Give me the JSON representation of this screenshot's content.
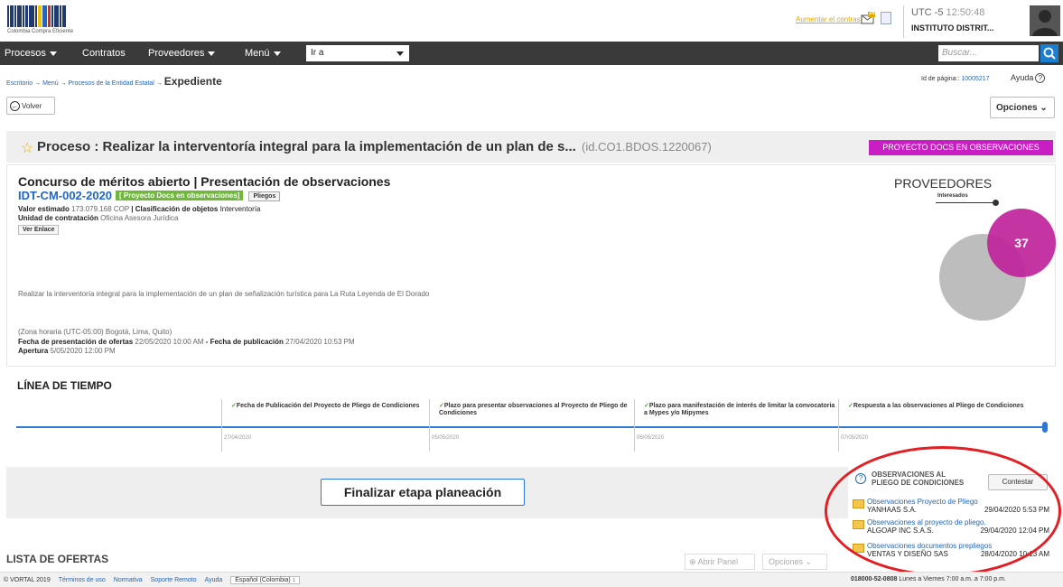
{
  "header": {
    "logo_text": "Colombia Compra Eficiente",
    "contrast_link": "Aumentar el contraste",
    "notification_count": "24",
    "utc_label": "UTC -5",
    "time": "12:50:48",
    "organization": "INSTITUTO DISTRIT..."
  },
  "nav": {
    "items": [
      "Procesos",
      "Contratos",
      "Proveedores",
      "Menú"
    ],
    "goto_value": "Ir a",
    "search_placeholder": "Buscar..."
  },
  "breadcrumb": {
    "items": [
      "Escritorio",
      "Menú",
      "Procesos de la Entidad Estatal"
    ],
    "current": "Expediente",
    "page_id_label": "Id de página::",
    "page_id": "10005217",
    "help_label": "Ayuda"
  },
  "buttons": {
    "back": "Volver",
    "options": "Opciones"
  },
  "process": {
    "title": "Proceso : Realizar la interventoría integral para la implementación de un plan de s...",
    "id": "(id.CO1.BDOS.1220067)",
    "status": "PROYECTO DOCS EN OBSERVACIONES",
    "modality": "Concurso de méritos abierto | Presentación de observaciones",
    "reference": "IDT-CM-002-2020",
    "phase_badge": "[ Proyecto Docs en observaciones]",
    "pliegos_tag": "Pliegos",
    "valor_label": "Valor estimado",
    "valor": "173.079.168 COP",
    "clasif_label": "| Clasificación de objetos",
    "clasif": "Interventoría",
    "unidad_label": "Unidad de contratación",
    "unidad": "Oficina Asesora Jurídica",
    "ver_enlace": "Ver Enlace",
    "description": "Realizar la interventoría integral para la implementación de un plan de señalización turística para La Ruta Leyenda de El Dorado",
    "timezone": "(Zona horaria (UTC-05:00) Bogotá, Lima, Quito)",
    "fecha_ofertas_label": "Fecha de presentación de ofertas",
    "fecha_ofertas": "22/05/2020 10:00 AM",
    "fecha_pub_label": "- Fecha de publicación",
    "fecha_pub": "27/04/2020 10:53 PM",
    "apertura_label": "Apertura",
    "apertura": "5/05/2020 12:00 PM"
  },
  "providers": {
    "title": "PROVEEDORES",
    "subtitle": "Interesados",
    "count": "37"
  },
  "timeline": {
    "title": "LÍNEA DE TIEMPO",
    "stages": [
      {
        "label": "Fecha de Publicación del Proyecto de Pliego de Condiciones",
        "date": "27/04/2020"
      },
      {
        "label": "Plazo para presentar observaciones al Proyecto de Pliego de Condiciones",
        "date": "05/05/2020"
      },
      {
        "label": "Plazo para manifestación de interés de limitar la convocatoria a Mypes y/o Mipymes",
        "date": "06/05/2020"
      },
      {
        "label": "Respuesta a las observaciones al Pliego de Condiciones",
        "date": "07/05/2020"
      }
    ]
  },
  "finalize_button": "Finalizar etapa planeación",
  "observations": {
    "title": "OBSERVACIONES AL PLIEGO DE CONDICIONES",
    "reply_button": "Contestar",
    "items": [
      {
        "title": "Observaciones Proyecto de Pliego",
        "by": "YANHAAS S.A.",
        "date": "29/04/2020 5:53 PM"
      },
      {
        "title": "Observaciones al proyecto de pliego.",
        "by": "ALGOAP INC S.A.S.",
        "date": "29/04/2020 12:04 PM"
      },
      {
        "title": "Observaciones documentos prepliegos",
        "by": "VENTAS Y DISEÑO SAS",
        "date": "28/04/2020 10:13 AM"
      }
    ]
  },
  "offers": {
    "title": "LISTA DE OFERTAS",
    "open_panel": "Abrir Panel",
    "options": "Opciones"
  },
  "footer": {
    "copyright": "© VORTAL 2019",
    "links": [
      "Términos de uso",
      "Normativa",
      "Soporte Remoto",
      "Ayuda"
    ],
    "language": "Español (Colombia)",
    "phone": "018000-52-0808",
    "hours": "Lunes a Viernes 7:00 a.m. a 7:00 p.m."
  },
  "colors": {
    "accent": "#1f66c8",
    "status": "#c81ec4",
    "annotation": "#e31e24"
  }
}
